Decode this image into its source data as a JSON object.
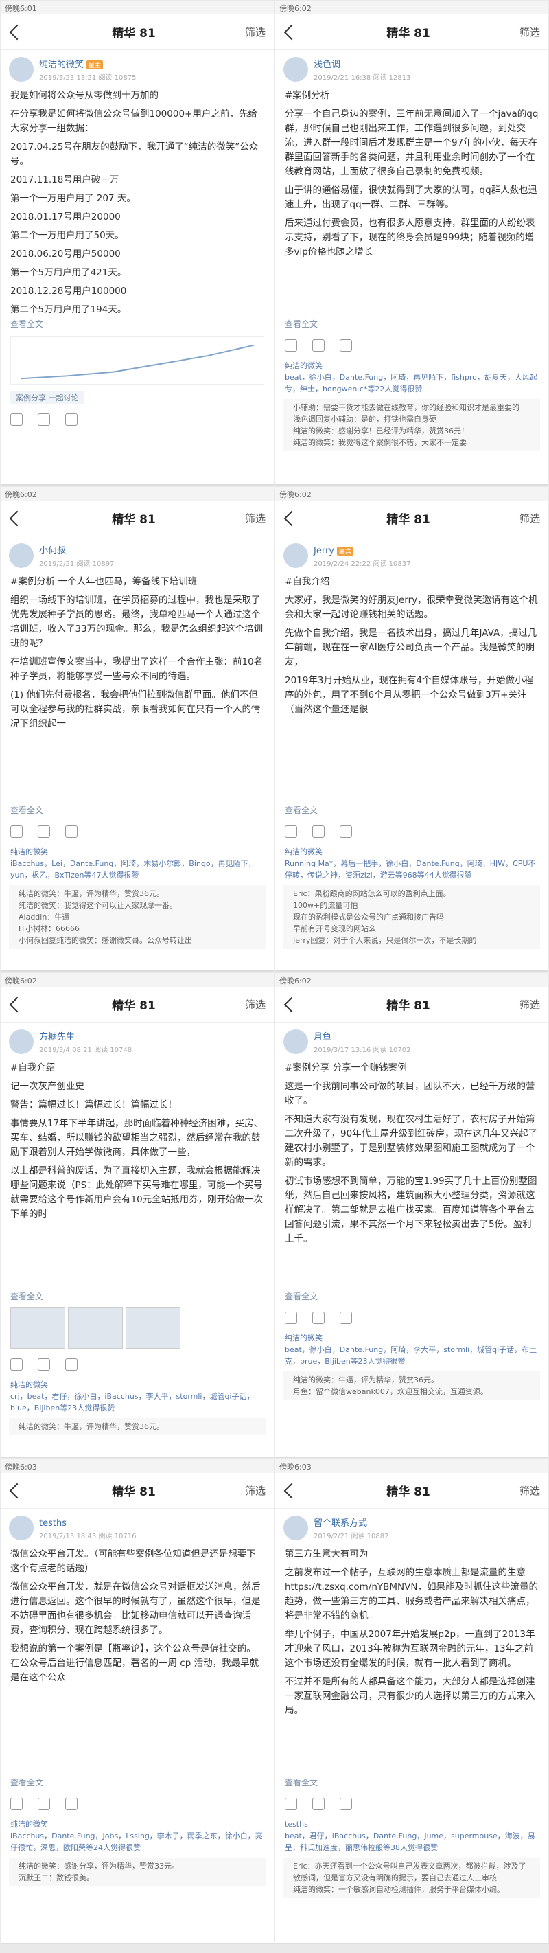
{
  "panels": [
    {
      "status": "傍晚6:01",
      "title": "精华 81",
      "filter": "筛选",
      "author": "纯洁的微笑",
      "badge": "星主",
      "date": "2019/3/23 13:21 阅读 10875",
      "text": [
        "我是如何将公众号从零做到十万加的",
        "在分享我是如何将微信公众号做到100000+用户之前，先给大家分享一组数据：",
        "2017.04.25号在朋友的鼓励下，我开通了“纯洁的微笑”公众号。",
        "2017.11.18号用户破一万",
        "第一个一万用户用了 207 天。",
        "2018.01.17号用户20000",
        "第二个一万用户用了50天。",
        "2018.06.20号用户50000",
        "第一个5万用户用了421天。",
        "2018.12.28号用户100000",
        "第二个5万用户用了194天。"
      ],
      "more": "查看全文",
      "tag": "案例分享 一起讨论"
    },
    {
      "status": "傍晚6:02",
      "title": "精华 81",
      "filter": "筛选",
      "author": "浅色调",
      "date": "2019/2/21 16:38 阅读 12813",
      "text": [
        "#案例分析",
        "分享一个自己身边的案例，三年前无意间加入了一个java的qq群，那时候自己也刚出来工作，工作遇到很多问题，到处交流，进入群一段时间后才发现群主是一个97年的小伙，每天在群里面回答新手的各类问题，并且利用业余时间创办了一个在线教育网站，上面放了很多自己录制的免费视频。",
        "由于讲的通俗易懂，很快就得到了大家的认可，qq群人数也迅速上升，出现了qq一群、二群、三群等。",
        "后来通过付费会员，也有很多人愿意支持，群里面的人纷纷表示支持，别看了下，现在的终身会员是999块；随着视频的增多vip价格也随之增长"
      ],
      "more": "查看全文",
      "likes": "纯洁的微笑",
      "likers": "beat，徐小白，Dante.Fung，阿琦，再见陌下，fishpro，胡夏天，大风起兮，绅士，hongwen.c*等22人觉得很赞",
      "comments": [
        "小辅助：需要干货才能去做在线教育，你的经验和知识才是最重要的",
        "浅色调回复小辅助：是的，打铁也需自身硬",
        "纯洁的微笑：感谢分享！已经评为精华，赞赏36元！",
        "纯洁的微笑：我觉得这个案例很不错，大家不一定要"
      ]
    },
    {
      "status": "傍晚6:02",
      "title": "精华 81",
      "filter": "筛选",
      "author": "小何叔",
      "date": "2019/2/21 阅读 10897",
      "text": [
        "#案例分析  一个人年也匹马，筹备线下培训班",
        "组织一场线下的培训班，在学员招募的过程中，我也是采取了优先发展种子学员的思路。最终，我单枪匹马一个人通过这个培训班，收入了33万的现金。那么，我是怎么组织起这个培训班的呢？",
        "在培训班宣传文案当中，我提出了这样一个合作主张：前10名种子学员，将能够享受一些与众不同的待遇。",
        "(1) 他们先付费报名，我会把他们拉到微信群里面。他们不但可以全程参与我的社群实战，亲眼看我如何在只有一个人的情况下组织起一"
      ],
      "more": "查看全文",
      "likes": "纯洁的微笑",
      "likers": "iBacchus，Lei，Dante.Fung，阿琦，木易小尔郎，Bingo，再见陌下，yun，枫乙，BxTizen等47人觉得很赞",
      "comments": [
        "纯洁的微笑：牛逼，评为精华，赞赏36元。",
        "纯洁的微笑：我觉得这个可以让大家观摩一番。",
        "Aladdin：牛逼",
        "IT小树林：66666",
        "小何叔回复纯洁的微笑：感谢微笑哥。公众号转让出"
      ]
    },
    {
      "status": "傍晚6:02",
      "title": "精华 81",
      "filter": "筛选",
      "author": "Jerry",
      "badge": "嘉宾",
      "date": "2019/2/24 22:22 阅读 10837",
      "text": [
        "#自我介绍",
        "大家好，我是微笑的好朋友Jerry，很荣幸受微笑邀请有这个机会和大家一起讨论赚钱相关的话题。",
        "先做个自我介绍，我是一名技术出身，搞过几年JAVA，搞过几年前端，现在在一家AI医疗公司负责一个产品。我是微笑的朋友，",
        "2019年3月开始从业，现在拥有4个自媒体账号，开始做小程序的外包，用了不到6个月从零把一个公众号做到3万+关注（当然这个量还是很"
      ],
      "more": "查看全文",
      "likes": "纯洁的微笑",
      "likers": "Running Ma*，幕后一把手，徐小白，Dante.Fung，阿琦，HJW，CPU不停转，传说之神，资源zizi，游云等968等44人觉得很赞",
      "comments": [
        "Eric：果粉跟商的网站怎么可以的盈利点上面。",
        "100w+的流量可怕",
        "现在的盈利模式是公众号的广点通和接广告吗",
        "早前有开号变现的网站么",
        "Jerry回复：对于个人来说，只是偶尔一次，不是长期的"
      ]
    },
    {
      "status": "傍晚6:02",
      "title": "精华 81",
      "filter": "筛选",
      "author": "方糖先生",
      "date": "2019/3/4 08:21 阅读 10748",
      "text": [
        "#自我介绍",
        "记一次灰产创业史",
        "警告：篇幅过长！篇幅过长！篇幅过长！",
        "事情要从17年下半年讲起，那时面临着种种经济困难，买房、买车、结婚，所以赚钱的欲望相当之强烈，然后经常在我的鼓励下跟着别人开始学做微商，具体做了一些，",
        "以上都是科普的废话，为了直接切入主题，我就会根据能解决哪些问题来说（PS：此处解释下买号难在哪里，可能一个买号就需要给这个号作新用户会有10元全站抵用券，刚开始做一次下单的时"
      ],
      "more": "查看全文",
      "likes": "纯洁的微笑",
      "likers": "crj，beat，君仔，徐小白，iBacchus，李大平，stormli，城管qi子话，blue，Bijiben等23人觉得很赞",
      "comments": [
        "纯洁的微笑：牛逼，评为精华，赞赏36元。"
      ]
    },
    {
      "status": "傍晚6:02",
      "title": "精华 81",
      "filter": "筛选",
      "author": "月鱼",
      "date": "2019/3/17 13:16 阅读 10702",
      "text": [
        "#案例分享  分享一个赚钱案例",
        "这是一个我前同事公司做的项目，团队不大，已经千万级的营收了。",
        "不知道大家有没有发现，现在农村生活好了，农村房子开始第二次升级了，90年代土屋升级到红砖房，现在这几年又兴起了建农村小别墅了，于是别墅装修效果图和施工图就成为了一个新的需求。",
        "初试市场感想不到简单，万能的宝1.99买了几十上百份别墅图纸，然后自己回来按风格，建筑面积大小整理分类，资源就这样解决了。第二部就是去推广找买家。百度知道等各个平台去回答问题引流，果不其然一个月下来轻松卖出去了5份。盈利上千。"
      ],
      "more": "查看全文",
      "likes": "纯洁的微笑",
      "likers": "beat，徐小白，Dante.Fung，阿琦，李大平，stormli，城管qi子话，布土克，brue，Bijiben等23人觉得很赞",
      "comments": [
        "纯洁的微笑：牛逼，评为精华，赞赏36元。",
        "月鱼：留个微信webank007，欢迎互相交流，互通资源。"
      ]
    },
    {
      "status": "傍晚6:03",
      "title": "精华 81",
      "filter": "筛选",
      "author": "tesths",
      "date": "2019/2/13 18:43 阅读 10716",
      "text": [
        "微信公众平台开发。（可能有些案例各位知道但是还是想要下这个有点老的话题）",
        "微信公众平台开发，就是在微信公众号对话框发送消息，然后进行信息返回。这个很早的时候就有了，虽然这个很早，但是不妨碍里面也有很多机会。比如移动电信就可以开通查询话费，查询积分、现在跨越系统很多了。",
        "我想说的第一个案例是【瓶率论】，这个公众号是偏社交的。在公众号后台进行信息匹配，著名的一周 cp 活动，我最早就是在这个公众"
      ],
      "more": "查看全文",
      "likes": "纯洁的微笑",
      "likers": "iBacchus，Dante.Fung，Jobs，Lssing，李木子，雨季之东，徐小白，亮仔很忙，深思，欧阳荣等24人觉得很赞",
      "comments": [
        "纯洁的微笑：感谢分享，评为精华，赞赏33元。",
        "沉默王二：数钱很美。"
      ]
    },
    {
      "status": "傍晚6:03",
      "title": "精华 81",
      "filter": "筛选",
      "author": "留个联系方式",
      "date": "2019/2/21 阅读 10882",
      "text": [
        "第三方生意大有可为",
        "之前发布过一个帖子，互联网的生意本质上都是流量的生意 https://t.zsxq.com/nYBMNVN，如果能及时抓住这些流量的趋势，做一些第三方的工具、服务或者产品来解决相关痛点，将是非常不错的商机。",
        "举几个例子，中国从2007年开始发展p2p，一直到了2013年才迎来了风口，2013年被称为互联网金融的元年，13年之前这个市场还没有全爆发的时候，就有一批人看到了商机。",
        "不过并不是所有的人都具备这个能力，大部分人都是选择创建一家互联网金融公司，只有很少的人选择以第三方的方式来入局。"
      ],
      "more": "查看全文",
      "likes": "tesths",
      "likers": "beat，君仔，iBacchus，Dante.Fung，Jume，supermouse，海波，易呈，科氏加速度，丽思伟拉般等38人觉得很赞",
      "comments": [
        "Eric：亦天还看到一个公众号叫自己发表文章两次，都被拦截，涉及了敏感词，但是官方又没有明确的提示，要自己去通过人工审核",
        "纯洁的微笑：一个敏感词自动检测插件，服务于平台媒体小编。"
      ]
    }
  ]
}
